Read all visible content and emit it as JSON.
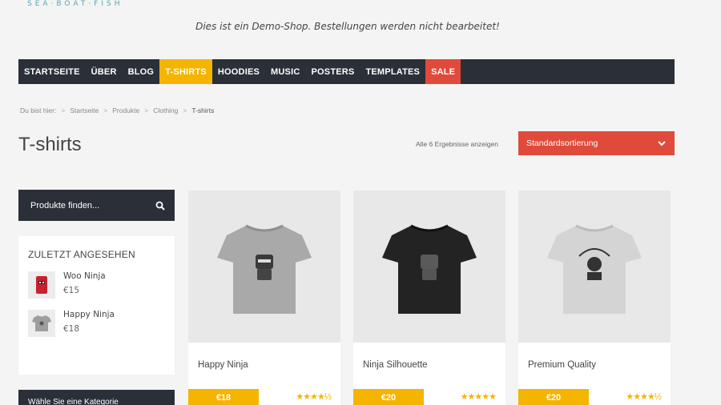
{
  "header": {
    "logo": "SEA·BOAT·FISH",
    "notice": "Dies ist ein Demo-Shop. Bestellungen werden nicht bearbeitet!"
  },
  "nav": {
    "items": [
      {
        "label": "STARTSEITE"
      },
      {
        "label": "ÜBER"
      },
      {
        "label": "BLOG"
      },
      {
        "label": "T-SHIRTS"
      },
      {
        "label": "HOODIES"
      },
      {
        "label": "MUSIC"
      },
      {
        "label": "POSTERS"
      },
      {
        "label": "TEMPLATES"
      },
      {
        "label": "SALE"
      }
    ],
    "active_color": "#f5b400",
    "sale_color": "#e04a3a"
  },
  "breadcrumb": {
    "prefix": "Du bist hier:",
    "items": [
      "Startseite",
      "Produkte",
      "Clothing",
      "T-shirts"
    ]
  },
  "page": {
    "title": "T-shirts",
    "result_count": "Alle 6 Ergebnisse anzeigen",
    "sort_selected": "Standardsortierung"
  },
  "sidebar": {
    "search_placeholder": "Produkte finden...",
    "recent_title": "ZULETZT ANGESEHEN",
    "recent": [
      {
        "name": "Woo Ninja",
        "price": "€15"
      },
      {
        "name": "Happy Ninja",
        "price": "€18"
      }
    ],
    "categories_title": "Wähle Sie eine Kategorie"
  },
  "products": [
    {
      "name": "Happy Ninja",
      "price": "€18",
      "stars": "★★★★½"
    },
    {
      "name": "Ninja Silhouette",
      "price": "€20",
      "stars": "★★★★★"
    },
    {
      "name": "Premium Quality",
      "price": "€20",
      "stars": "★★★★½"
    }
  ]
}
